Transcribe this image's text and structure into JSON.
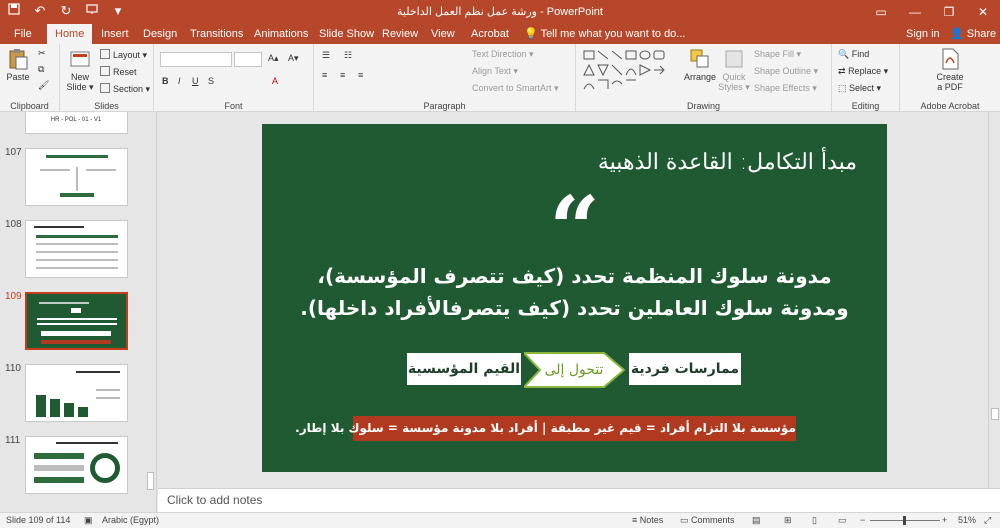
{
  "window": {
    "title": "ورشة عمل نظم العمل الداخلية  -  PowerPoint",
    "qat": [
      "save-icon",
      "undo-icon",
      "redo-icon",
      "present-icon",
      "customize-icon"
    ],
    "controls": [
      "ribbon-display-icon",
      "minimize-icon",
      "restore-icon",
      "close-icon"
    ]
  },
  "tabs": {
    "items": [
      "File",
      "Home",
      "Insert",
      "Design",
      "Transitions",
      "Animations",
      "Slide Show",
      "Review",
      "View",
      "Acrobat"
    ],
    "active": "Home",
    "tell_me": "Tell me what you want to do...",
    "sign_in": "Sign in",
    "share": "Share"
  },
  "ribbon": {
    "clipboard": {
      "label": "Clipboard",
      "paste": "Paste"
    },
    "slides": {
      "label": "Slides",
      "new_slide": "New\nSlide",
      "new_slide_line1": "New",
      "new_slide_line2": "Slide ▾",
      "layout": "Layout ▾",
      "reset": "Reset",
      "section": "Section ▾"
    },
    "font": {
      "label": "Font",
      "font_name": "",
      "font_size": ""
    },
    "paragraph": {
      "label": "Paragraph",
      "text_direction": "Text Direction ▾",
      "align_text": "Align Text ▾",
      "convert_smartart": "Convert to SmartArt ▾"
    },
    "drawing": {
      "label": "Drawing",
      "arrange": "Arrange",
      "quick_styles_1": "Quick",
      "quick_styles_2": "Styles ▾",
      "shape_fill": "Shape Fill ▾",
      "shape_outline": "Shape Outline ▾",
      "shape_effects": "Shape Effects ▾"
    },
    "editing": {
      "label": "Editing",
      "find": "Find",
      "replace": "Replace ▾",
      "select": "Select ▾"
    },
    "acrobat": {
      "label": "Adobe Acrobat",
      "create_pdf_1": "Create",
      "create_pdf_2": "a PDF"
    }
  },
  "thumbnails": [
    {
      "num": "",
      "header": "HR - POL - 01 - V1"
    },
    {
      "num": "107"
    },
    {
      "num": "108"
    },
    {
      "num": "109",
      "active": true
    },
    {
      "num": "110"
    },
    {
      "num": "111"
    }
  ],
  "slide": {
    "title": "مبدأ التكامل: القاعدة الذهبية",
    "quote_glyph": "“",
    "body_line1": "مدونة سلوك المنظمة تحدد (كيف تتصرف المؤسسة)،",
    "body_line2": "ومدونة سلوك العاملين تحدد (كيف يتصرفالأفراد داخلها).",
    "box_right": "ممارسات فردية",
    "arrow_label": "تتحول إلى",
    "box_left": "القيم المؤسسية",
    "footer": "مؤسسة بلا التزام أفراد = قيم غير مطبقة | أفراد بلا مدونة مؤسسة = سلوك بلا إطار.",
    "colors": {
      "background": "#1f5a33",
      "accent": "#b0391f",
      "arrow": "#8bb63a"
    }
  },
  "notes": {
    "placeholder": "Click to add notes"
  },
  "status": {
    "slide_info": "Slide 109 of 114",
    "language": "Arabic (Egypt)",
    "notes": "Notes",
    "comments": "Comments",
    "zoom": "51%"
  }
}
